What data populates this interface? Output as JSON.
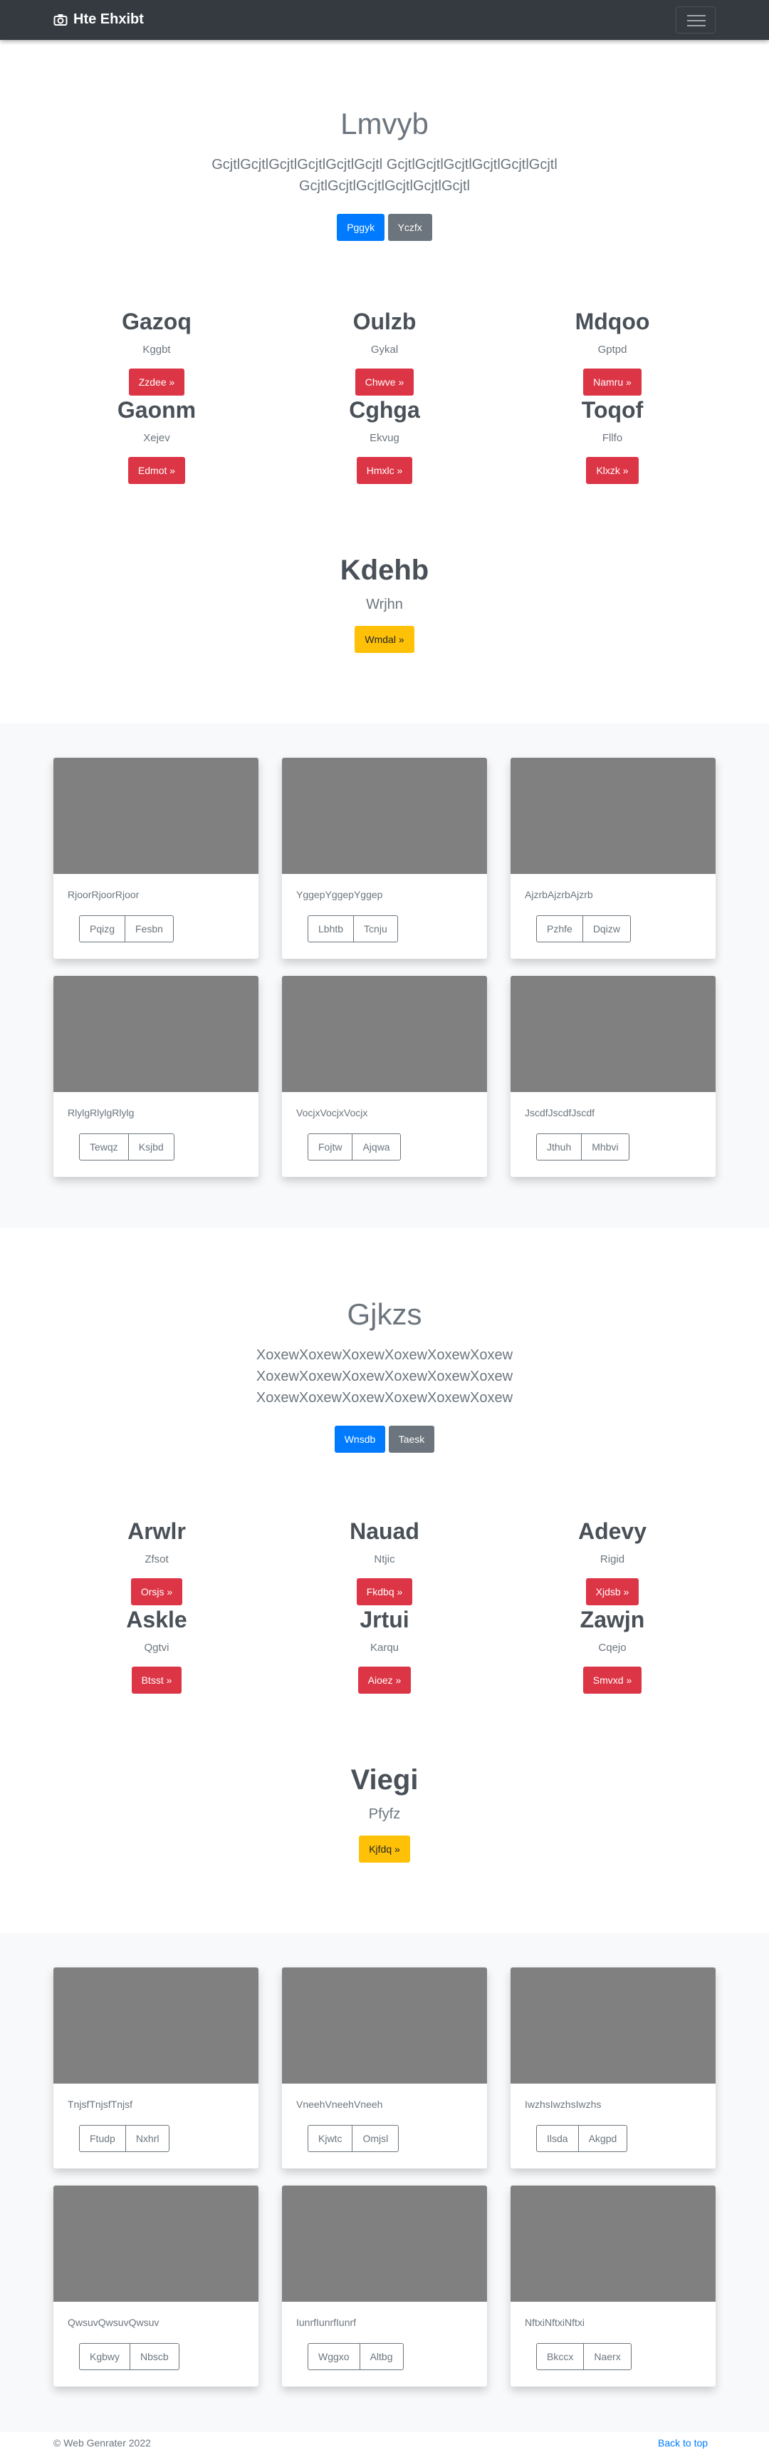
{
  "navbar": {
    "brand": "Hte Ehxibt",
    "camera_icon": "camera-icon",
    "menu_icon": "hamburger-icon"
  },
  "section1": {
    "jumbotron": {
      "title": "Lmvyb",
      "lead_line1": "GcjtlGcjtlGcjtlGcjtlGcjtlGcjtl GcjtlGcjtlGcjtlGcjtlGcjtlGcjtl",
      "lead_line2": "GcjtlGcjtlGcjtlGcjtlGcjtlGcjtl",
      "btn_primary": "Pggyk",
      "btn_secondary": "Yczfx"
    },
    "headings": [
      {
        "title": "Gazoq",
        "sub": "Kggbt",
        "btn": "Zzdee »"
      },
      {
        "title": "Oulzb",
        "sub": "Gykal",
        "btn": "Chwve »"
      },
      {
        "title": "Mdqoo",
        "sub": "Gptpd",
        "btn": "Namru »"
      },
      {
        "title": "Gaonm",
        "sub": "Xejev",
        "btn": "Edmot »"
      },
      {
        "title": "Cghga",
        "sub": "Ekvug",
        "btn": "Hmxlc »"
      },
      {
        "title": "Toqof",
        "sub": "Fllfo",
        "btn": "Klxzk »"
      }
    ],
    "feature": {
      "title": "Kdehb",
      "sub": "Wrjhn",
      "btn": "Wmdal »"
    }
  },
  "album1": [
    {
      "text": "RjoorRjoorRjoor",
      "b1": "Pqizg",
      "b2": "Fesbn"
    },
    {
      "text": "YggepYggepYggep",
      "b1": "Lbhtb",
      "b2": "Tcnju"
    },
    {
      "text": "AjzrbAjzrbAjzrb",
      "b1": "Pzhfe",
      "b2": "Dqizw"
    },
    {
      "text": "RlylgRlylgRlylg",
      "b1": "Tewqz",
      "b2": "Ksjbd"
    },
    {
      "text": "VocjxVocjxVocjx",
      "b1": "Fojtw",
      "b2": "Ajqwa"
    },
    {
      "text": "JscdfJscdfJscdf",
      "b1": "Jthuh",
      "b2": "Mhbvi"
    }
  ],
  "section2": {
    "jumbotron": {
      "title": "Gjkzs",
      "lead_line1": "XoxewXoxewXoxewXoxewXoxewXoxew",
      "lead_line2": "XoxewXoxewXoxewXoxewXoxewXoxew",
      "lead_line3": "XoxewXoxewXoxewXoxewXoxewXoxew",
      "btn_primary": "Wnsdb",
      "btn_secondary": "Taesk"
    },
    "headings": [
      {
        "title": "Arwlr",
        "sub": "Zfsot",
        "btn": "Orsjs »"
      },
      {
        "title": "Nauad",
        "sub": "Ntjic",
        "btn": "Fkdbq »"
      },
      {
        "title": "Adevy",
        "sub": "Rigid",
        "btn": "Xjdsb »"
      },
      {
        "title": "Askle",
        "sub": "Qgtvi",
        "btn": "Btsst »"
      },
      {
        "title": "Jrtui",
        "sub": "Karqu",
        "btn": "Aioez »"
      },
      {
        "title": "Zawjn",
        "sub": "Cqejo",
        "btn": "Smvxd »"
      }
    ],
    "feature": {
      "title": "Viegi",
      "sub": "Pfyfz",
      "btn": "Kjfdq »"
    }
  },
  "album2": [
    {
      "text": "TnjsfTnjsfTnjsf",
      "b1": "Ftudp",
      "b2": "Nxhrl"
    },
    {
      "text": "VneehVneehVneeh",
      "b1": "Kjwtc",
      "b2": "Omjsl"
    },
    {
      "text": "IwzhsIwzhsIwzhs",
      "b1": "Ilsda",
      "b2": "Akgpd"
    },
    {
      "text": "QwsuvQwsuvQwsuv",
      "b1": "Kgbwy",
      "b2": "Nbscb"
    },
    {
      "text": "IunrfIunrfIunrf",
      "b1": "Wggxo",
      "b2": "Altbg"
    },
    {
      "text": "NftxiNftxiNftxi",
      "b1": "Bkccx",
      "b2": "Naerx"
    }
  ],
  "footer": {
    "copyright": "© Web Genrater 2022",
    "back_to_top": "Back to top"
  }
}
